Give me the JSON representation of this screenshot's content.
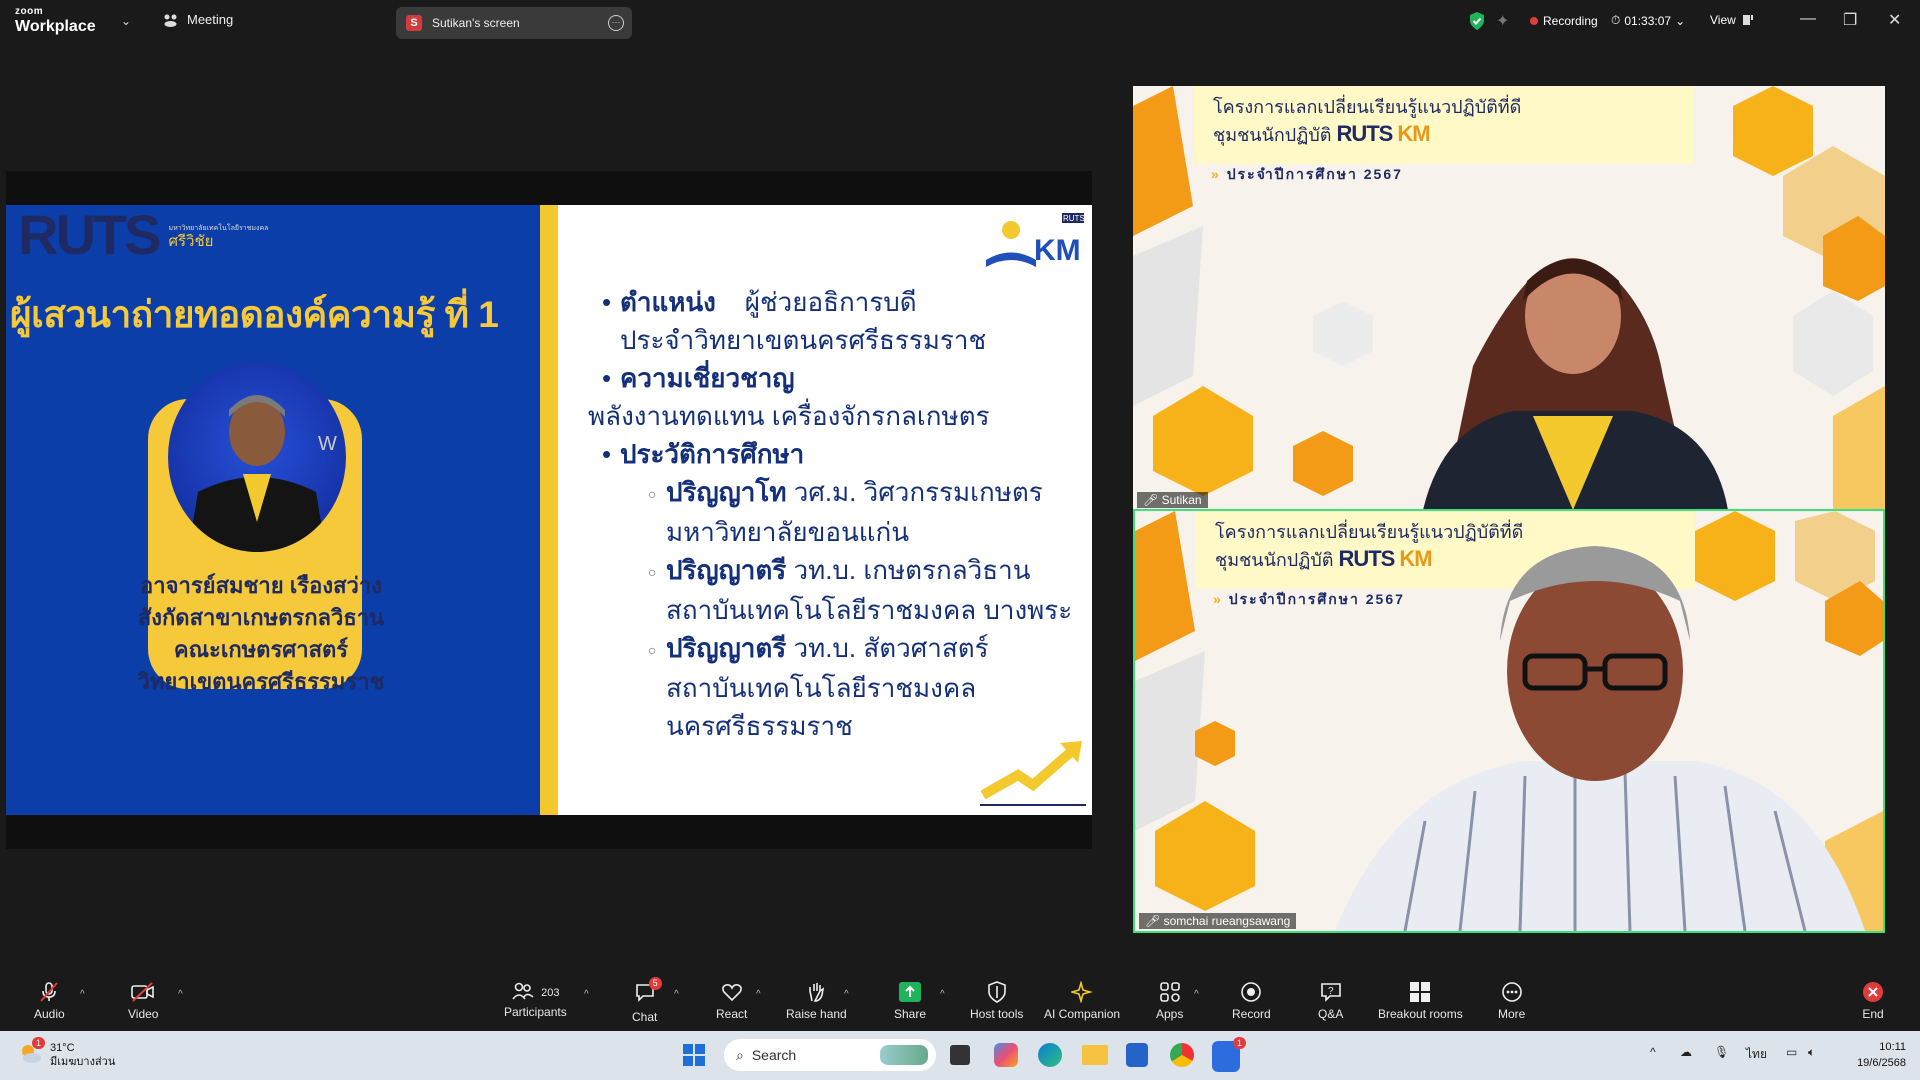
{
  "app": {
    "brand_top": "zoom",
    "brand_name": "Workplace",
    "meeting_label": "Meeting"
  },
  "screen_tab": {
    "initial": "S",
    "label": "Sutikan's screen"
  },
  "status": {
    "recording": "Recording",
    "timer": "01:33:07",
    "view": "View"
  },
  "slide": {
    "logo_text": "RUTS",
    "logo_sub_small": "มหาวิทยาลัยเทคโนโลยีราชมงคล",
    "logo_sub": "ศรีวิชัย",
    "title": "ผู้เสวนาถ่ายทอดองค์ความรู้ ที่ 1",
    "person_lines": [
      "อาจารย์สมชาย  เรืองสว่าง",
      "สังกัดสาขาเกษตรกลวิธาน",
      "คณะเกษตรศาสตร์",
      "วิทยาเขตนครศรีธรรมราช"
    ],
    "watermark": "W",
    "km_logo": "KM",
    "km_logo_small": "RUTS",
    "b1_head": "ตำแหน่ง",
    "b1_val": "ผู้ช่วยอธิการบดี",
    "b1_line2": "ประจำวิทยาเขตนครศรีธรรมราช",
    "b2_head": "ความเชี่ยวชาญ",
    "b2_line": "พลังงานทดแทน   เครื่องจักรกลเกษตร",
    "b3_head": "ประวัติการศึกษา",
    "edu": [
      {
        "degree": "ปริญญาโท",
        "detail": "วศ.ม. วิศวกรรมเกษตร",
        "line2": "มหาวิทยาลัยขอนแก่น",
        "line3": ""
      },
      {
        "degree": "ปริญญาตรี",
        "detail": "วท.บ. เกษตรกลวิธาน",
        "line2": "สถาบันเทคโนโลยีราชมงคล บางพระ",
        "line3": ""
      },
      {
        "degree": "ปริญญาตรี",
        "detail": "วท.บ. สัตวศาสตร์",
        "line2": "สถาบันเทคโนโลยีราชมงคล",
        "line3": "นครศรีธรรมราช"
      }
    ]
  },
  "banner": {
    "line1": "โครงการแลกเปลี่ยนเรียนรู้แนวปฏิบัติที่ดี",
    "line2": "ชุมชนนักปฏิบัติ",
    "ruts": "RUTS",
    "km": "KM",
    "line3": "ประจำปีการศึกษา 2567"
  },
  "tiles": [
    {
      "name": "Sutikan"
    },
    {
      "name": "somchai rueangsawang"
    }
  ],
  "toolbar": {
    "audio": "Audio",
    "video": "Video",
    "participants": "Participants",
    "participants_count": "203",
    "chat": "Chat",
    "chat_badge": "5",
    "react": "React",
    "raise_hand": "Raise hand",
    "share": "Share",
    "host_tools": "Host tools",
    "ai_companion": "AI Companion",
    "apps": "Apps",
    "record": "Record",
    "qa": "Q&A",
    "breakout": "Breakout rooms",
    "more": "More",
    "end": "End"
  },
  "taskbar": {
    "temp": "31°C",
    "weather_desc": "มีเมฆบางส่วน",
    "weather_badge": "1",
    "search": "Search",
    "zoom_badge": "1",
    "lang": "ไทย",
    "time": "10:11",
    "date": "19/6/2568"
  },
  "colors": {
    "slide_blue": "#0b3ea8",
    "slide_yellow": "#f4c92e",
    "record_red": "#e23b3b",
    "active_speaker": "#3ee07a"
  }
}
